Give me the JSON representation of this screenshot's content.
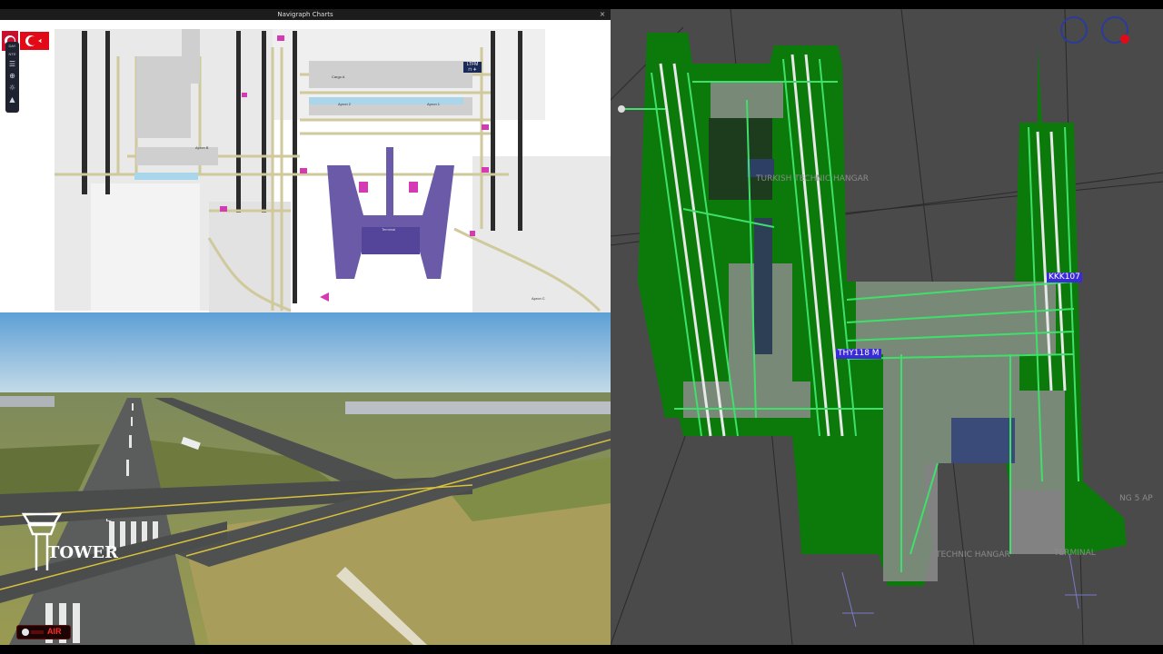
{
  "charts": {
    "title": "Navigraph Charts",
    "close": "×",
    "toolbar": {
      "items": [
        "☰",
        "⊕",
        "☼",
        "▲"
      ],
      "text1": "DAY",
      "text2": "NTE"
    },
    "ltfm": {
      "code": "LTFM",
      "sub": "⊓ ✈"
    },
    "labels": [
      "Cargo A",
      "Apron 2",
      "Terminal",
      "Apron 1",
      "Apron B",
      "Apron C"
    ]
  },
  "scene": {
    "tower_text": "TOWER",
    "onair": "AIR"
  },
  "radar": {
    "tags": [
      "THY118 M",
      "KKK107"
    ],
    "labels": [
      "TURKISH TECHNIC HANGAR",
      "TECHNIC HANGAR",
      "TERMINAL",
      "NG 5 AP"
    ],
    "colors": {
      "ground": "#0b7a0b",
      "taxiway": "#3fe06a",
      "apron": "#9a9a9a",
      "background": "#4a4a4a",
      "tag": "#3b2bd6"
    }
  }
}
